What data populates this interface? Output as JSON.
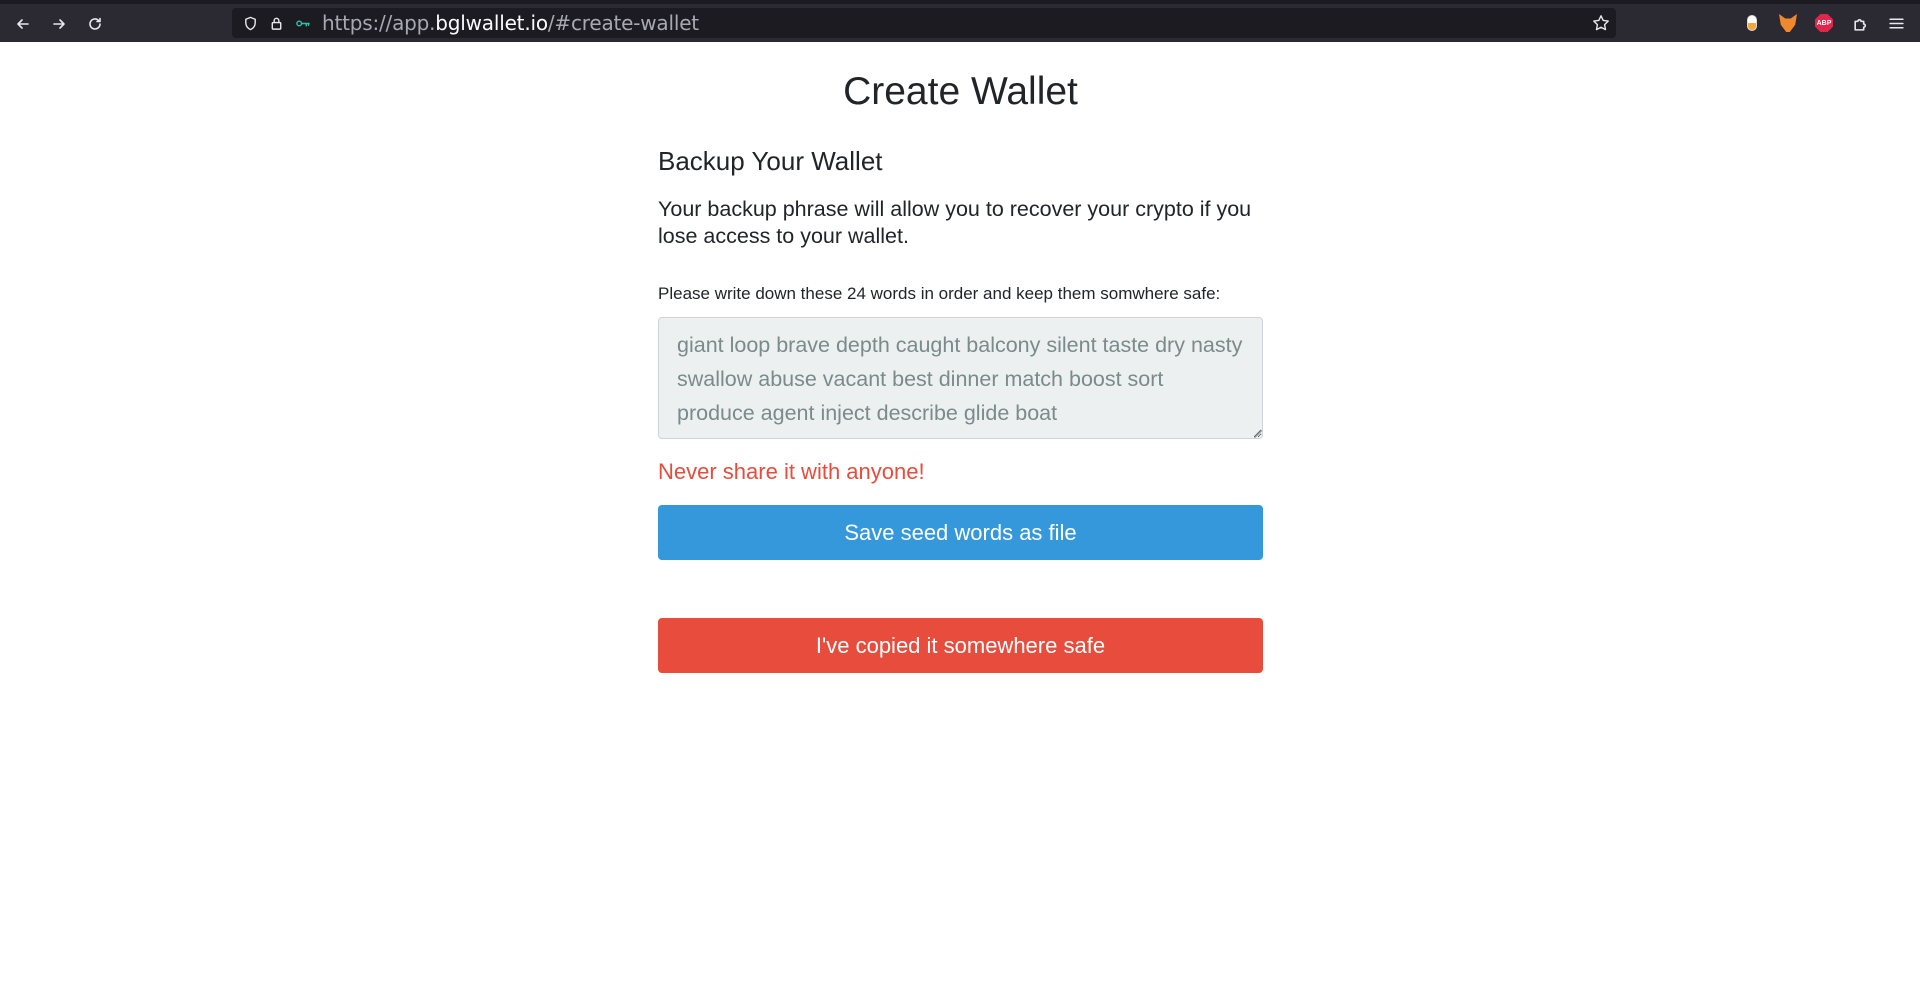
{
  "browser": {
    "url_prefix": "https://app.",
    "url_host": "bglwallet.io",
    "url_path": "/#create-wallet",
    "extensions": [
      "capsule-extension-icon",
      "metamask-fox-icon",
      "adblock-plus-icon",
      "extensions-puzzle-icon"
    ],
    "abp_label": "ABP"
  },
  "page": {
    "title": "Create Wallet",
    "section_title": "Backup Your Wallet",
    "description": "Your backup phrase will allow you to recover your crypto if you lose access to your wallet.",
    "instruction": "Please write down these 24 words in order and keep them somwhere safe:",
    "seed_words": "giant loop brave depth caught balcony silent taste dry nasty swallow abuse vacant best dinner match boost sort produce agent inject describe glide boat",
    "warning": "Never share it with anyone!",
    "save_button": "Save seed words as file",
    "confirm_button": "I've copied it somewhere safe"
  },
  "colors": {
    "toolbar_bg": "#2b2a33",
    "urlbar_bg": "#1c1b22",
    "primary": "#3498db",
    "danger": "#e74c3c",
    "textarea_bg": "#ecf0f1",
    "textarea_text": "#7b8a8b"
  }
}
